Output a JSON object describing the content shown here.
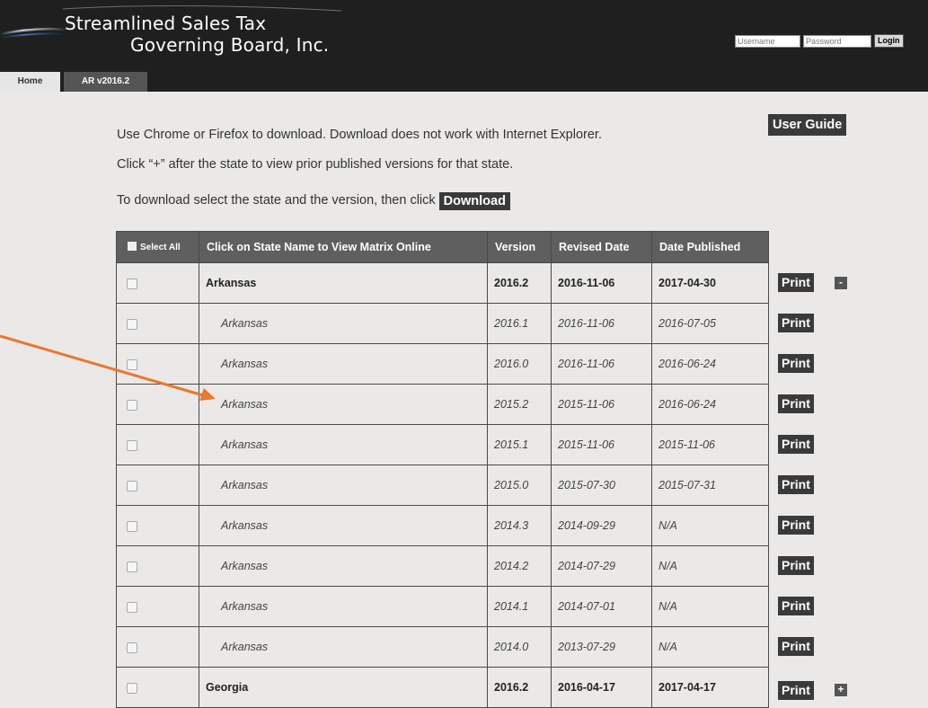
{
  "header": {
    "logo_line1": "Streamlined Sales Tax",
    "logo_line2": "Governing Board, Inc.",
    "username_placeholder": "Username",
    "password_placeholder": "Password",
    "login_label": "Login"
  },
  "nav": {
    "tabs": [
      {
        "label": "Home"
      },
      {
        "label": "AR v2016.2"
      }
    ]
  },
  "instructions": {
    "line1": "Use Chrome or Firefox to download. Download does not work with Internet Explorer.",
    "line2": "Click “+” after the state to view prior published versions for that state.",
    "line3": "To download select the state and the version, then click",
    "download_label": "Download",
    "user_guide_label": "User Guide"
  },
  "table": {
    "headers": {
      "select_all": "Select All",
      "state": "Click on State Name to View Matrix Online",
      "version": "Version",
      "revised": "Revised Date",
      "published": "Date Published"
    },
    "rows": [
      {
        "state": "Arkansas",
        "version": "2016.2",
        "revised": "2016-11-06",
        "published": "2017-04-30"
      },
      {
        "state": "Arkansas",
        "version": "2016.1",
        "revised": "2016-11-06",
        "published": "2016-07-05"
      },
      {
        "state": "Arkansas",
        "version": "2016.0",
        "revised": "2016-11-06",
        "published": "2016-06-24"
      },
      {
        "state": "Arkansas",
        "version": "2015.2",
        "revised": "2015-11-06",
        "published": "2016-06-24"
      },
      {
        "state": "Arkansas",
        "version": "2015.1",
        "revised": "2015-11-06",
        "published": "2015-11-06"
      },
      {
        "state": "Arkansas",
        "version": "2015.0",
        "revised": "2015-07-30",
        "published": "2015-07-31"
      },
      {
        "state": "Arkansas",
        "version": "2014.3",
        "revised": "2014-09-29",
        "published": "N/A"
      },
      {
        "state": "Arkansas",
        "version": "2014.2",
        "revised": "2014-07-29",
        "published": "N/A"
      },
      {
        "state": "Arkansas",
        "version": "2014.1",
        "revised": "2014-07-01",
        "published": "N/A"
      },
      {
        "state": "Arkansas",
        "version": "2014.0",
        "revised": "2013-07-29",
        "published": "N/A"
      },
      {
        "state": "Georgia",
        "version": "2016.2",
        "revised": "2016-04-17",
        "published": "2017-04-17"
      }
    ]
  },
  "actions": {
    "print_label": "Print",
    "collapse_label": "-",
    "expand_label": "+"
  },
  "colors": {
    "header_bg": "#1f1f1f",
    "page_bg": "#eae9e7",
    "table_header_bg": "#5f5f5f",
    "button_bg": "#3a3a3a",
    "annotation_arrow": "#e8792d"
  }
}
